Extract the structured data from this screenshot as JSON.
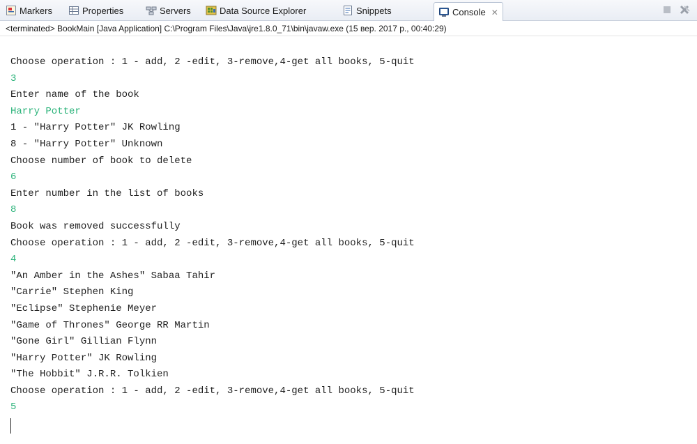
{
  "tabs": [
    {
      "label": "Markers",
      "icon": "markers-icon"
    },
    {
      "label": "Properties",
      "icon": "properties-icon"
    },
    {
      "label": "Servers",
      "icon": "servers-icon"
    },
    {
      "label": "Data Source Explorer",
      "icon": "data-source-explorer-icon"
    },
    {
      "label": "Snippets",
      "icon": "snippets-icon"
    },
    {
      "label": "Console",
      "icon": "console-icon",
      "active": true,
      "close": "✕"
    }
  ],
  "view_buttons": [
    {
      "name": "terminate-icon"
    },
    {
      "name": "remove-launch-icon"
    }
  ],
  "console": {
    "header": "<terminated> BookMain [Java Application] C:\\Program Files\\Java\\jre1.8.0_71\\bin\\javaw.exe (15 вер. 2017 р., 00:40:29)",
    "lines": [
      {
        "text": "Choose operation : 1 - add, 2 -edit, 3-remove,4-get all books, 5-quit",
        "type": "output"
      },
      {
        "text": "3",
        "type": "input"
      },
      {
        "text": "Enter name of the book",
        "type": "output"
      },
      {
        "text": "Harry Potter",
        "type": "input"
      },
      {
        "text": "1 - \"Harry Potter\" JK Rowling",
        "type": "output"
      },
      {
        "text": "8 - \"Harry Potter\" Unknown",
        "type": "output"
      },
      {
        "text": "Choose number of book to delete",
        "type": "output"
      },
      {
        "text": "6",
        "type": "input"
      },
      {
        "text": "Enter number in the list of books",
        "type": "output"
      },
      {
        "text": "8",
        "type": "input"
      },
      {
        "text": "Book was removed successfully",
        "type": "output"
      },
      {
        "text": "Choose operation : 1 - add, 2 -edit, 3-remove,4-get all books, 5-quit",
        "type": "output"
      },
      {
        "text": "4",
        "type": "input"
      },
      {
        "text": "\"An Amber in the Ashes\" Sabaa Tahir",
        "type": "output"
      },
      {
        "text": "\"Carrie\" Stephen King",
        "type": "output"
      },
      {
        "text": "\"Eclipse\" Stephenie Meyer",
        "type": "output"
      },
      {
        "text": "\"Game of Thrones\" George RR Martin",
        "type": "output"
      },
      {
        "text": "\"Gone Girl\" Gillian Flynn",
        "type": "output"
      },
      {
        "text": "\"Harry Potter\" JK Rowling",
        "type": "output"
      },
      {
        "text": "\"The Hobbit\" J.R.R. Tolkien",
        "type": "output"
      },
      {
        "text": "Choose operation : 1 - add, 2 -edit, 3-remove,4-get all books, 5-quit",
        "type": "output"
      },
      {
        "text": "5",
        "type": "input"
      }
    ]
  },
  "colors": {
    "stdout": "#1f1f1f",
    "stdin": "#2bb37a",
    "tab_bar": "#e9edf4"
  }
}
